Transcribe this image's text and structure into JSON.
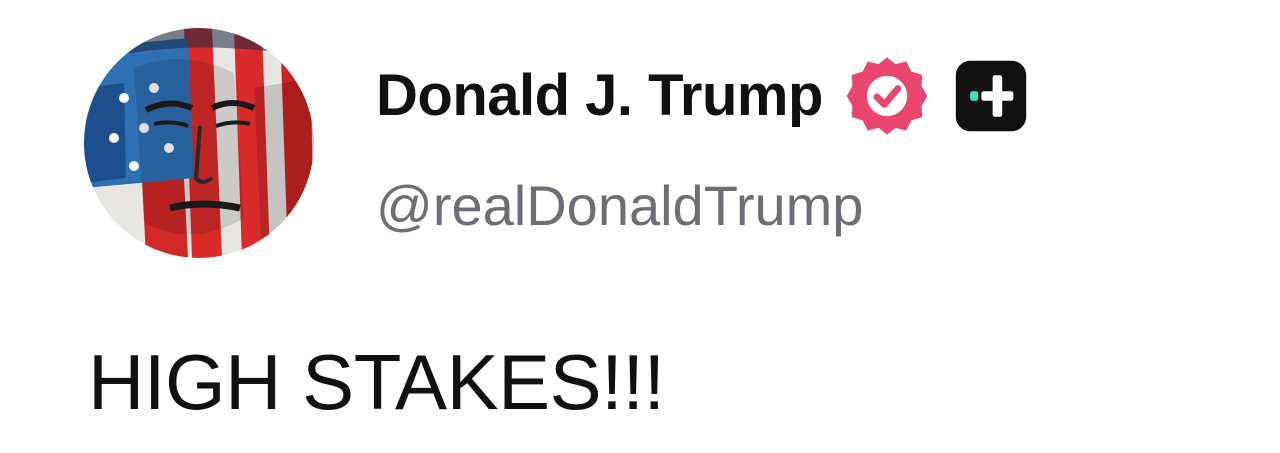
{
  "post": {
    "author": {
      "display_name": "Donald J. Trump",
      "handle": "@realDonaldTrump",
      "avatar_icon": "avatar-flag-portrait",
      "verified_icon": "verified-badge-icon",
      "verified_color": "#e8466c",
      "plus_badge_icon": "plus-badge-icon",
      "plus_badge_color": "#111111"
    },
    "text": "HIGH STAKES!!!"
  }
}
